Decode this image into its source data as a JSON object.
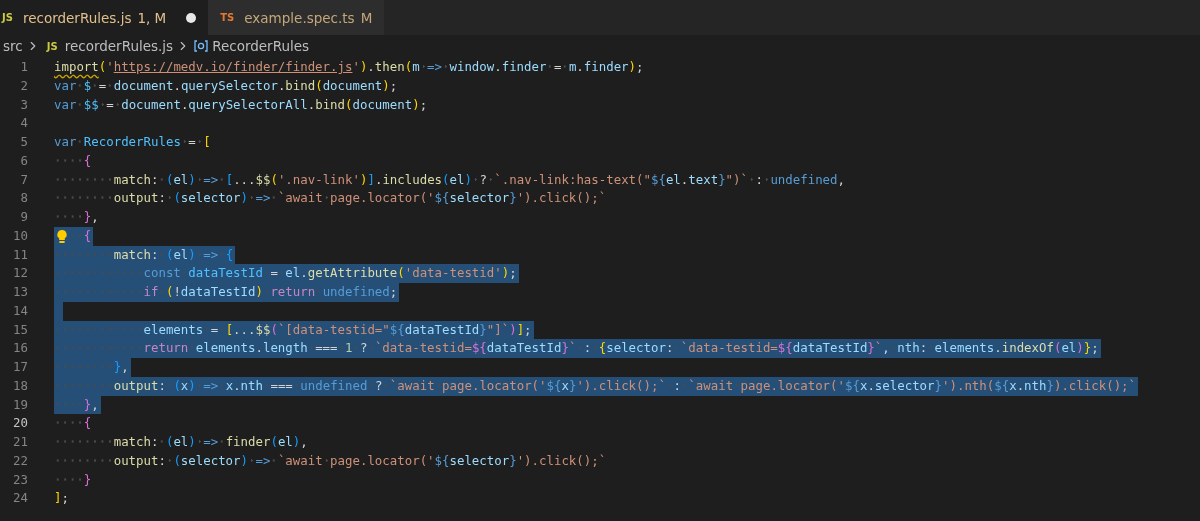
{
  "tabs": [
    {
      "lang": "JS",
      "color": "#cbcb41",
      "name": "recorderRules.js",
      "status": "1, M",
      "dirty": true,
      "selected": true
    },
    {
      "lang": "TS",
      "color": "#e37933",
      "name": "example.spec.ts",
      "status": "M",
      "selected": false
    }
  ],
  "breadcrumbs": [
    {
      "kind": "folder",
      "label": "src"
    },
    {
      "kind": "file",
      "lang": "JS",
      "color": "#cbcb41",
      "label": "recorderRules.js"
    },
    {
      "kind": "symbol",
      "label": "RecorderRules"
    }
  ],
  "lines": [
    {
      "number": "1",
      "selected": false,
      "current": false,
      "tokens": [
        {
          "kind": "fnerr",
          "text": "import"
        },
        {
          "kind": "b1",
          "text": "("
        },
        {
          "kind": "str",
          "text": "'"
        },
        {
          "kind": "link",
          "text": "https://medv.io/finder/finder.js"
        },
        {
          "kind": "str",
          "text": "'"
        },
        {
          "kind": "b1",
          "text": ")"
        },
        {
          "kind": "p",
          "text": "."
        },
        {
          "kind": "fn",
          "text": "then"
        },
        {
          "kind": "b1",
          "text": "("
        },
        {
          "kind": "var",
          "text": "m"
        },
        {
          "kind": "kw",
          "text": " =>"
        },
        {
          "kind": "var",
          "text": " window"
        },
        {
          "kind": "p",
          "text": "."
        },
        {
          "kind": "var",
          "text": "finder"
        },
        {
          "kind": "p",
          "text": " = "
        },
        {
          "kind": "var",
          "text": "m"
        },
        {
          "kind": "p",
          "text": "."
        },
        {
          "kind": "var",
          "text": "finder"
        },
        {
          "kind": "b1",
          "text": ")"
        },
        {
          "kind": "p",
          "text": ";"
        }
      ]
    },
    {
      "number": "2",
      "selected": false,
      "current": false,
      "tokens": [
        {
          "kind": "kw",
          "text": "var"
        },
        {
          "kind": "const",
          "text": " $"
        },
        {
          "kind": "p",
          "text": " = "
        },
        {
          "kind": "var",
          "text": "document"
        },
        {
          "kind": "p",
          "text": "."
        },
        {
          "kind": "var",
          "text": "querySelector"
        },
        {
          "kind": "p",
          "text": "."
        },
        {
          "kind": "fn",
          "text": "bind"
        },
        {
          "kind": "b1",
          "text": "("
        },
        {
          "kind": "var",
          "text": "document"
        },
        {
          "kind": "b1",
          "text": ")"
        },
        {
          "kind": "p",
          "text": ";"
        }
      ]
    },
    {
      "number": "3",
      "selected": false,
      "current": false,
      "tokens": [
        {
          "kind": "kw",
          "text": "var"
        },
        {
          "kind": "const",
          "text": " $$"
        },
        {
          "kind": "p",
          "text": " = "
        },
        {
          "kind": "var",
          "text": "document"
        },
        {
          "kind": "p",
          "text": "."
        },
        {
          "kind": "var",
          "text": "querySelectorAll"
        },
        {
          "kind": "p",
          "text": "."
        },
        {
          "kind": "fn",
          "text": "bind"
        },
        {
          "kind": "b1",
          "text": "("
        },
        {
          "kind": "var",
          "text": "document"
        },
        {
          "kind": "b1",
          "text": ")"
        },
        {
          "kind": "p",
          "text": ";"
        }
      ]
    },
    {
      "number": "4",
      "selected": false,
      "current": false
    },
    {
      "number": "5",
      "selected": false,
      "current": false,
      "tokens": [
        {
          "kind": "kw",
          "text": "var"
        },
        {
          "kind": "const",
          "text": " RecorderRules"
        },
        {
          "kind": "p",
          "text": " = "
        },
        {
          "kind": "b1",
          "text": "["
        }
      ]
    },
    {
      "number": "6",
      "selected": false,
      "current": false,
      "tokens": [
        {
          "kind": "b2",
          "text": "    {"
        }
      ]
    },
    {
      "number": "7",
      "selected": false,
      "current": false,
      "tokens": [
        {
          "kind": "fn",
          "text": "        match"
        },
        {
          "kind": "p",
          "text": ": "
        },
        {
          "kind": "b3",
          "text": "("
        },
        {
          "kind": "var",
          "text": "el"
        },
        {
          "kind": "b3",
          "text": ")"
        },
        {
          "kind": "kw",
          "text": " =>"
        },
        {
          "kind": "b3",
          "text": " ["
        },
        {
          "kind": "p",
          "text": "..."
        },
        {
          "kind": "fn",
          "text": "$$"
        },
        {
          "kind": "b1",
          "text": "("
        },
        {
          "kind": "str",
          "text": "'.nav-link'"
        },
        {
          "kind": "b1",
          "text": ")"
        },
        {
          "kind": "b3",
          "text": "]"
        },
        {
          "kind": "p",
          "text": "."
        },
        {
          "kind": "fn",
          "text": "includes"
        },
        {
          "kind": "b3",
          "text": "("
        },
        {
          "kind": "var",
          "text": "el"
        },
        {
          "kind": "b3",
          "text": ")"
        },
        {
          "kind": "p",
          "text": " ? "
        },
        {
          "kind": "str",
          "text": "`.nav-link:has-text(\""
        },
        {
          "kind": "kw",
          "text": "${"
        },
        {
          "kind": "var",
          "text": "el"
        },
        {
          "kind": "p",
          "text": "."
        },
        {
          "kind": "var",
          "text": "text"
        },
        {
          "kind": "kw",
          "text": "}"
        },
        {
          "kind": "str",
          "text": "\")`"
        },
        {
          "kind": "p",
          "text": " : "
        },
        {
          "kind": "kw",
          "text": "undefined"
        },
        {
          "kind": "p",
          "text": ","
        }
      ]
    },
    {
      "number": "8",
      "selected": false,
      "current": false,
      "tokens": [
        {
          "kind": "fn",
          "text": "        output"
        },
        {
          "kind": "p",
          "text": ": "
        },
        {
          "kind": "b3",
          "text": "("
        },
        {
          "kind": "var",
          "text": "selector"
        },
        {
          "kind": "b3",
          "text": ")"
        },
        {
          "kind": "kw",
          "text": " =>"
        },
        {
          "kind": "str",
          "text": " `await page.locator('"
        },
        {
          "kind": "kw",
          "text": "${"
        },
        {
          "kind": "var",
          "text": "selector"
        },
        {
          "kind": "kw",
          "text": "}"
        },
        {
          "kind": "str",
          "text": "').click();`"
        }
      ]
    },
    {
      "number": "9",
      "selected": false,
      "current": false,
      "tokens": [
        {
          "kind": "b2",
          "text": "    }"
        },
        {
          "kind": "p",
          "text": ","
        }
      ]
    },
    {
      "number": "10",
      "selected": true,
      "current": false,
      "lightbulb": true,
      "tokens": [
        {
          "kind": "b2",
          "text": "    {"
        }
      ]
    },
    {
      "number": "11",
      "selected": true,
      "current": false,
      "tokens": [
        {
          "kind": "fn",
          "text": "        match"
        },
        {
          "kind": "p",
          "text": ": "
        },
        {
          "kind": "b3",
          "text": "("
        },
        {
          "kind": "var",
          "text": "el"
        },
        {
          "kind": "b3",
          "text": ")"
        },
        {
          "kind": "kw",
          "text": " =>"
        },
        {
          "kind": "b3",
          "text": " {"
        }
      ]
    },
    {
      "number": "12",
      "selected": true,
      "current": false,
      "tokens": [
        {
          "kind": "kw",
          "text": "            const"
        },
        {
          "kind": "const",
          "text": " dataTestId"
        },
        {
          "kind": "p",
          "text": " = "
        },
        {
          "kind": "var",
          "text": "el"
        },
        {
          "kind": "p",
          "text": "."
        },
        {
          "kind": "fn",
          "text": "getAttribute"
        },
        {
          "kind": "b1",
          "text": "("
        },
        {
          "kind": "str",
          "text": "'data-testid'"
        },
        {
          "kind": "b1",
          "text": ")"
        },
        {
          "kind": "p",
          "text": ";"
        }
      ]
    },
    {
      "number": "13",
      "selected": true,
      "current": false,
      "tokens": [
        {
          "kind": "ctl",
          "text": "            if"
        },
        {
          "kind": "b1",
          "text": " ("
        },
        {
          "kind": "p",
          "text": "!"
        },
        {
          "kind": "var",
          "text": "dataTestId"
        },
        {
          "kind": "b1",
          "text": ")"
        },
        {
          "kind": "ctl",
          "text": " return"
        },
        {
          "kind": "kw",
          "text": " undefined"
        },
        {
          "kind": "p",
          "text": ";"
        }
      ]
    },
    {
      "number": "14",
      "selected": true,
      "current": false
    },
    {
      "number": "15",
      "selected": true,
      "current": false,
      "tokens": [
        {
          "kind": "var",
          "text": "            elements"
        },
        {
          "kind": "p",
          "text": " = "
        },
        {
          "kind": "b1",
          "text": "["
        },
        {
          "kind": "p",
          "text": "..."
        },
        {
          "kind": "fn",
          "text": "$$"
        },
        {
          "kind": "b2",
          "text": "("
        },
        {
          "kind": "str",
          "text": "`[data-testid=\""
        },
        {
          "kind": "kw",
          "text": "${"
        },
        {
          "kind": "var",
          "text": "dataTestId"
        },
        {
          "kind": "kw",
          "text": "}"
        },
        {
          "kind": "str",
          "text": "\"]`"
        },
        {
          "kind": "b2",
          "text": ")"
        },
        {
          "kind": "b1",
          "text": "]"
        },
        {
          "kind": "p",
          "text": ";"
        }
      ]
    },
    {
      "number": "16",
      "selected": true,
      "current": false,
      "tokens": [
        {
          "kind": "ctl",
          "text": "            return"
        },
        {
          "kind": "var",
          "text": " elements"
        },
        {
          "kind": "p",
          "text": "."
        },
        {
          "kind": "var",
          "text": "length"
        },
        {
          "kind": "p",
          "text": " === "
        },
        {
          "kind": "num",
          "text": "1"
        },
        {
          "kind": "p",
          "text": " ? "
        },
        {
          "kind": "str",
          "text": "`data-testid="
        },
        {
          "kind": "b2",
          "text": "${"
        },
        {
          "kind": "var",
          "text": "dataTestId"
        },
        {
          "kind": "b2",
          "text": "}"
        },
        {
          "kind": "str",
          "text": "`"
        },
        {
          "kind": "p",
          "text": " : "
        },
        {
          "kind": "b1",
          "text": "{"
        },
        {
          "kind": "var",
          "text": "selector"
        },
        {
          "kind": "p",
          "text": ": "
        },
        {
          "kind": "str",
          "text": "`data-testid="
        },
        {
          "kind": "b2",
          "text": "${"
        },
        {
          "kind": "var",
          "text": "dataTestId"
        },
        {
          "kind": "b2",
          "text": "}"
        },
        {
          "kind": "str",
          "text": "`"
        },
        {
          "kind": "p",
          "text": ", "
        },
        {
          "kind": "var",
          "text": "nth"
        },
        {
          "kind": "p",
          "text": ": "
        },
        {
          "kind": "var",
          "text": "elements"
        },
        {
          "kind": "p",
          "text": "."
        },
        {
          "kind": "fn",
          "text": "indexOf"
        },
        {
          "kind": "b2",
          "text": "("
        },
        {
          "kind": "var",
          "text": "el"
        },
        {
          "kind": "b2",
          "text": ")"
        },
        {
          "kind": "b1",
          "text": "}"
        },
        {
          "kind": "p",
          "text": ";"
        }
      ]
    },
    {
      "number": "17",
      "selected": true,
      "current": false,
      "tokens": [
        {
          "kind": "b3",
          "text": "        }"
        },
        {
          "kind": "p",
          "text": ","
        }
      ]
    },
    {
      "number": "18",
      "selected": true,
      "current": false,
      "tokens": [
        {
          "kind": "fn",
          "text": "        output"
        },
        {
          "kind": "p",
          "text": ": "
        },
        {
          "kind": "b3",
          "text": "("
        },
        {
          "kind": "var",
          "text": "x"
        },
        {
          "kind": "b3",
          "text": ")"
        },
        {
          "kind": "kw",
          "text": " =>"
        },
        {
          "kind": "var",
          "text": " x"
        },
        {
          "kind": "p",
          "text": "."
        },
        {
          "kind": "var",
          "text": "nth"
        },
        {
          "kind": "p",
          "text": " === "
        },
        {
          "kind": "kw",
          "text": "undefined"
        },
        {
          "kind": "p",
          "text": " ? "
        },
        {
          "kind": "str",
          "text": "`await page.locator('"
        },
        {
          "kind": "kw",
          "text": "${"
        },
        {
          "kind": "var",
          "text": "x"
        },
        {
          "kind": "kw",
          "text": "}"
        },
        {
          "kind": "str",
          "text": "').click();`"
        },
        {
          "kind": "p",
          "text": " : "
        },
        {
          "kind": "str",
          "text": "`await page.locator('"
        },
        {
          "kind": "kw",
          "text": "${"
        },
        {
          "kind": "var",
          "text": "x"
        },
        {
          "kind": "p",
          "text": "."
        },
        {
          "kind": "var",
          "text": "selector"
        },
        {
          "kind": "kw",
          "text": "}"
        },
        {
          "kind": "str",
          "text": "').nth("
        },
        {
          "kind": "kw",
          "text": "${"
        },
        {
          "kind": "var",
          "text": "x"
        },
        {
          "kind": "p",
          "text": "."
        },
        {
          "kind": "var",
          "text": "nth"
        },
        {
          "kind": "kw",
          "text": "}"
        },
        {
          "kind": "str",
          "text": ").click();`"
        }
      ]
    },
    {
      "number": "19",
      "selected": true,
      "current": false,
      "tokens": [
        {
          "kind": "b2",
          "text": "    }"
        },
        {
          "kind": "p",
          "text": ","
        }
      ]
    },
    {
      "number": "20",
      "selected": false,
      "current": true,
      "tokens": [
        {
          "kind": "b2",
          "text": "    {"
        }
      ]
    },
    {
      "number": "21",
      "selected": false,
      "current": false,
      "tokens": [
        {
          "kind": "fn",
          "text": "        match"
        },
        {
          "kind": "p",
          "text": ": "
        },
        {
          "kind": "b3",
          "text": "("
        },
        {
          "kind": "var",
          "text": "el"
        },
        {
          "kind": "b3",
          "text": ")"
        },
        {
          "kind": "kw",
          "text": " =>"
        },
        {
          "kind": "fn",
          "text": " finder"
        },
        {
          "kind": "b3",
          "text": "("
        },
        {
          "kind": "var",
          "text": "el"
        },
        {
          "kind": "b3",
          "text": ")"
        },
        {
          "kind": "p",
          "text": ","
        }
      ]
    },
    {
      "number": "22",
      "selected": false,
      "current": false,
      "tokens": [
        {
          "kind": "fn",
          "text": "        output"
        },
        {
          "kind": "p",
          "text": ": "
        },
        {
          "kind": "b3",
          "text": "("
        },
        {
          "kind": "var",
          "text": "selector"
        },
        {
          "kind": "b3",
          "text": ")"
        },
        {
          "kind": "kw",
          "text": " =>"
        },
        {
          "kind": "str",
          "text": " `await page.locator('"
        },
        {
          "kind": "kw",
          "text": "${"
        },
        {
          "kind": "var",
          "text": "selector"
        },
        {
          "kind": "kw",
          "text": "}"
        },
        {
          "kind": "str",
          "text": "').click();`"
        }
      ]
    },
    {
      "number": "23",
      "selected": false,
      "current": false,
      "tokens": [
        {
          "kind": "b2",
          "text": "    }"
        }
      ]
    },
    {
      "number": "24",
      "selected": false,
      "current": false,
      "tokens": [
        {
          "kind": "b1",
          "text": "]"
        },
        {
          "kind": "p",
          "text": ";"
        }
      ]
    }
  ]
}
